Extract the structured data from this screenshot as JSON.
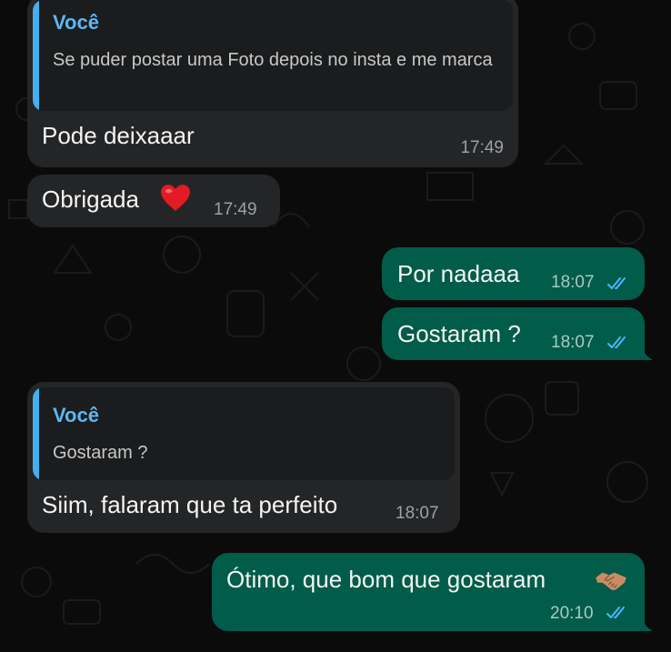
{
  "colors": {
    "background": "#0b0b0c",
    "incoming_bubble": "#242526",
    "outgoing_bubble": "#025c4a",
    "quote_bar": "#43aff0",
    "read_ticks": "#4fb3ff"
  },
  "messages": [
    {
      "direction": "incoming",
      "quote": {
        "author": "Você",
        "text": "Se puder postar uma Foto depois no insta e me marca"
      },
      "text": "Pode deixaaar",
      "time": "17:49"
    },
    {
      "direction": "incoming",
      "text": "Obrigada",
      "emoji": "heart-emoji",
      "time": "17:49"
    },
    {
      "direction": "outgoing",
      "text": "Por nadaaa",
      "time": "18:07",
      "status": "read"
    },
    {
      "direction": "outgoing",
      "text": "Gostaram ?",
      "time": "18:07",
      "status": "read"
    },
    {
      "direction": "incoming",
      "quote": {
        "author": "Você",
        "text": "Gostaram ?"
      },
      "text": "Siim, falaram que ta perfeito",
      "time": "18:07"
    },
    {
      "direction": "outgoing",
      "text": "Ótimo, que bom que gostaram",
      "emoji": "handshake-emoji",
      "time": "20:10",
      "status": "read"
    }
  ]
}
